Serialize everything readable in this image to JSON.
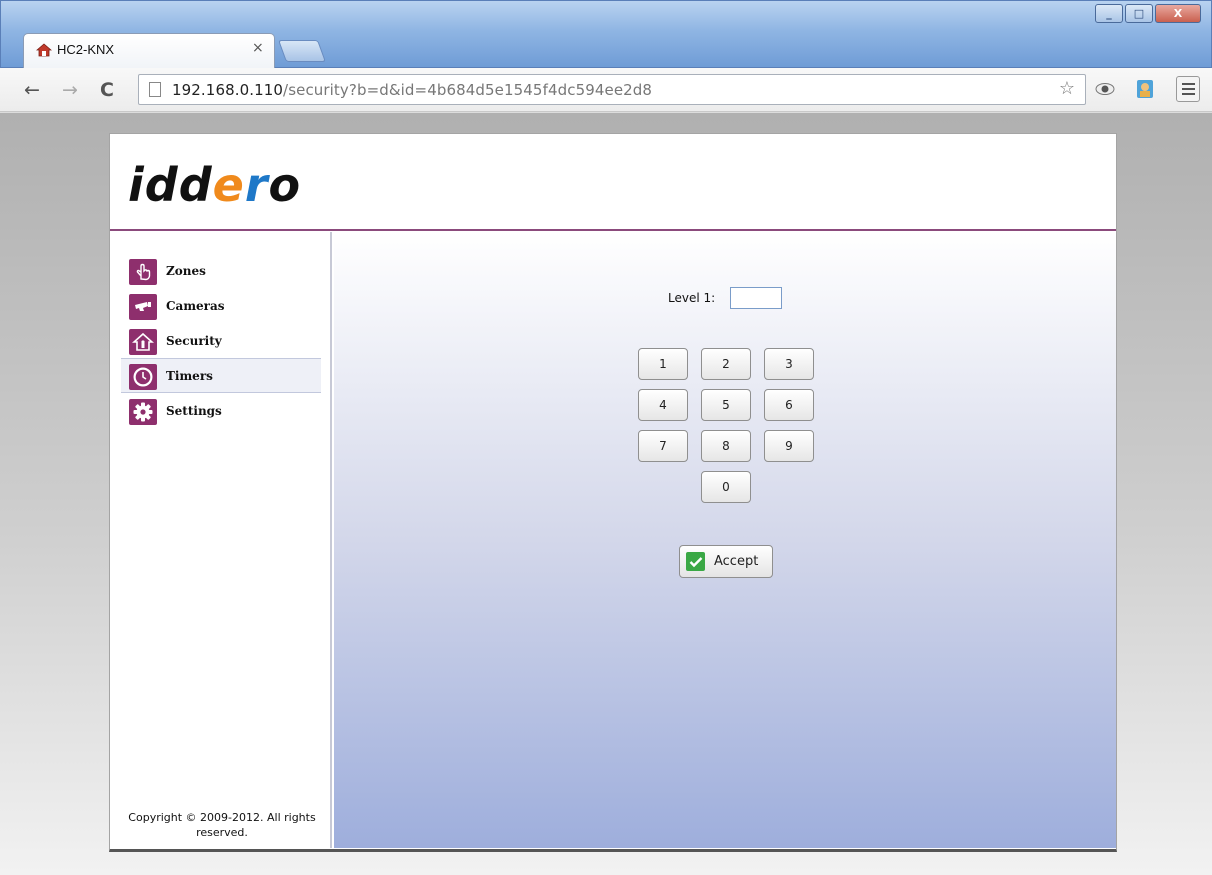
{
  "browser": {
    "tab_title": "HC2-KNX",
    "tab_close": "×",
    "url_host": "192.168.0.110",
    "url_path": "/security?b=d&id=4b684d5e1545f4dc594ee2d8",
    "window_controls": {
      "minimize": "_",
      "maximize": "□",
      "close": "X"
    }
  },
  "app": {
    "logo": {
      "p1": "idd",
      "p2": "e",
      "p3": "r",
      "p4": "o"
    },
    "sidebar": {
      "items": [
        {
          "label": "Zones",
          "icon": "hand-pointer-icon"
        },
        {
          "label": "Cameras",
          "icon": "camera-icon"
        },
        {
          "label": "Security",
          "icon": "house-security-icon"
        },
        {
          "label": "Timers",
          "icon": "clock-icon",
          "active": true
        },
        {
          "label": "Settings",
          "icon": "gear-icon"
        }
      ],
      "copyright": "Copyright © 2009-2012. All rights reserved."
    },
    "security": {
      "level_label": "Level 1:",
      "level_value": "",
      "keys": [
        "1",
        "2",
        "3",
        "4",
        "5",
        "6",
        "7",
        "8",
        "9",
        "0"
      ],
      "accept_label": "Accept"
    }
  },
  "colors": {
    "accent": "#8e2f6d",
    "header_line": "#8b4a7c",
    "accept_check": "#3aa845"
  }
}
